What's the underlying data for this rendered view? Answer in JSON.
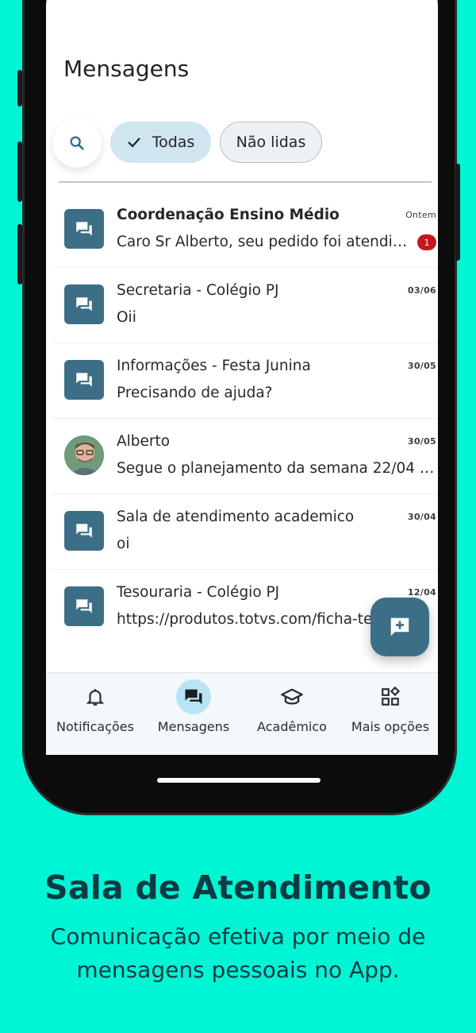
{
  "colors": {
    "background": "#00F5D4",
    "accent": "#3c6f87",
    "chip_selected": "#cfe5ef",
    "badge": "#c4161c",
    "text_dark": "#0c3b44"
  },
  "header": {
    "title": "Mensagens"
  },
  "filters": {
    "search_icon": "search-icon",
    "chips": [
      {
        "label": "Todas",
        "selected": true
      },
      {
        "label": "Não lidas",
        "selected": false
      }
    ]
  },
  "messages": [
    {
      "name": "Coordenação Ensino Médio",
      "preview": "Caro Sr Alberto, seu pedido foi atendido",
      "date": "Ontem",
      "unread": "1",
      "icon": "chat-icon",
      "bold": true
    },
    {
      "name": "Secretaria - Colégio PJ",
      "preview": "Oii",
      "date": "03/06",
      "icon": "chat-icon"
    },
    {
      "name": "Informações - Festa Junina",
      "preview": "Precisando de ajuda?",
      "date": "30/05",
      "icon": "chat-icon"
    },
    {
      "name": "Alberto",
      "preview": "Segue o planejamento da semana 22/04 a ...",
      "date": "30/05",
      "icon": "user-photo"
    },
    {
      "name": "Sala de atendimento academico",
      "preview": "oi",
      "date": "30/04",
      "icon": "chat-icon"
    },
    {
      "name": "Tesouraria - Colégio PJ",
      "preview": "https://produtos.totvs.com/ficha-tecnica/tot...",
      "date": "12/04",
      "icon": "chat-icon"
    }
  ],
  "fab": {
    "icon": "new-message-icon"
  },
  "bottom_nav": [
    {
      "label": "Notificações",
      "icon": "bell-icon",
      "active": false
    },
    {
      "label": "Mensagens",
      "icon": "chat-icon",
      "active": true
    },
    {
      "label": "Acadêmico",
      "icon": "graduation-cap-icon",
      "active": false
    },
    {
      "label": "Mais opções",
      "icon": "grid-icon",
      "active": false
    }
  ],
  "promo": {
    "headline": "Sala de Atendimento",
    "subline": "Comunicação efetiva por meio de mensagens pessoais no App."
  }
}
